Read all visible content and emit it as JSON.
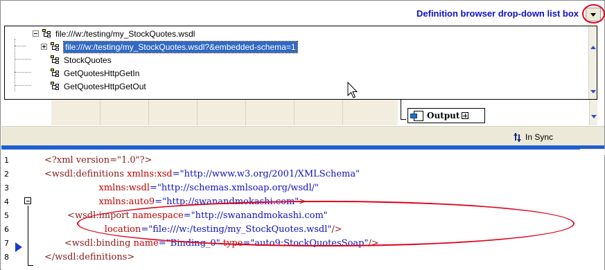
{
  "callout": {
    "text": "Definition browser drop-down list box"
  },
  "tree": {
    "items": [
      {
        "label": "file:///w:/testing/my_StockQuotes.wsdl",
        "expanded": true,
        "selected": false
      },
      {
        "label": "file:///w:/testing/my_StockQuotes.wsdl?&embedded-schema=1",
        "expanded": false,
        "selected": true
      },
      {
        "label": "StockQuotes"
      },
      {
        "label": "GetQuotesHttpGetIn"
      },
      {
        "label": "GetQuotesHttpGetOut"
      }
    ]
  },
  "diagram": {
    "output_label": "Output"
  },
  "status": {
    "sync_label": "In Sync"
  },
  "editor": {
    "lines": [
      {
        "n": "1",
        "parts": [
          {
            "t": "<?xml version=\"1.0\"?>",
            "c": "tag"
          }
        ]
      },
      {
        "n": "2",
        "parts": [
          {
            "t": "<wsdl:definitions ",
            "c": "tag"
          },
          {
            "t": "xmlns:xsd",
            "c": "attr"
          },
          {
            "t": "=\"http://www.w3.org/2001/XMLSchema\"",
            "c": "val"
          }
        ]
      },
      {
        "n": "3",
        "parts": [
          {
            "t": "                   ",
            "c": "tag"
          },
          {
            "t": "xmlns:wsdl",
            "c": "attr"
          },
          {
            "t": "=\"http://schemas.xmlsoap.org/wsdl/\"",
            "c": "val"
          }
        ]
      },
      {
        "n": "4",
        "parts": [
          {
            "t": "                   ",
            "c": "tag"
          },
          {
            "t": "xmlns:auto9",
            "c": "attr"
          },
          {
            "t": "=\"http://swanandmokashi.com\"",
            "c": "val"
          },
          {
            "t": ">",
            "c": "tag"
          }
        ]
      },
      {
        "n": "5",
        "parts": [
          {
            "t": "        <wsdl:import ",
            "c": "tag"
          },
          {
            "t": "namespace",
            "c": "attr"
          },
          {
            "t": "=\"http://swanandmokashi.com\"",
            "c": "val"
          }
        ]
      },
      {
        "n": "6",
        "parts": [
          {
            "t": "                     ",
            "c": "tag"
          },
          {
            "t": "location",
            "c": "attr"
          },
          {
            "t": "=\"file:///w:/testing/my_StockQuotes.wsdl\"",
            "c": "val"
          },
          {
            "t": "/>",
            "c": "tag"
          }
        ]
      },
      {
        "n": "7",
        "parts": [
          {
            "t": "       <wsdl:binding ",
            "c": "tag"
          },
          {
            "t": "name",
            "c": "attr"
          },
          {
            "t": "=\"Binding_0\" ",
            "c": "val"
          },
          {
            "t": "type",
            "c": "attr"
          },
          {
            "t": "=\"auto9:StockQuotesSoap\"",
            "c": "val"
          },
          {
            "t": "/>",
            "c": "tag"
          }
        ]
      },
      {
        "n": "8",
        "parts": [
          {
            "t": "</wsdl:definitions>",
            "c": "tag"
          }
        ]
      }
    ]
  },
  "colors": {
    "highlight": "#316ac5",
    "callout": "#1010c8",
    "annotation": "#e0001c",
    "splitter": "#1f5fd0"
  }
}
